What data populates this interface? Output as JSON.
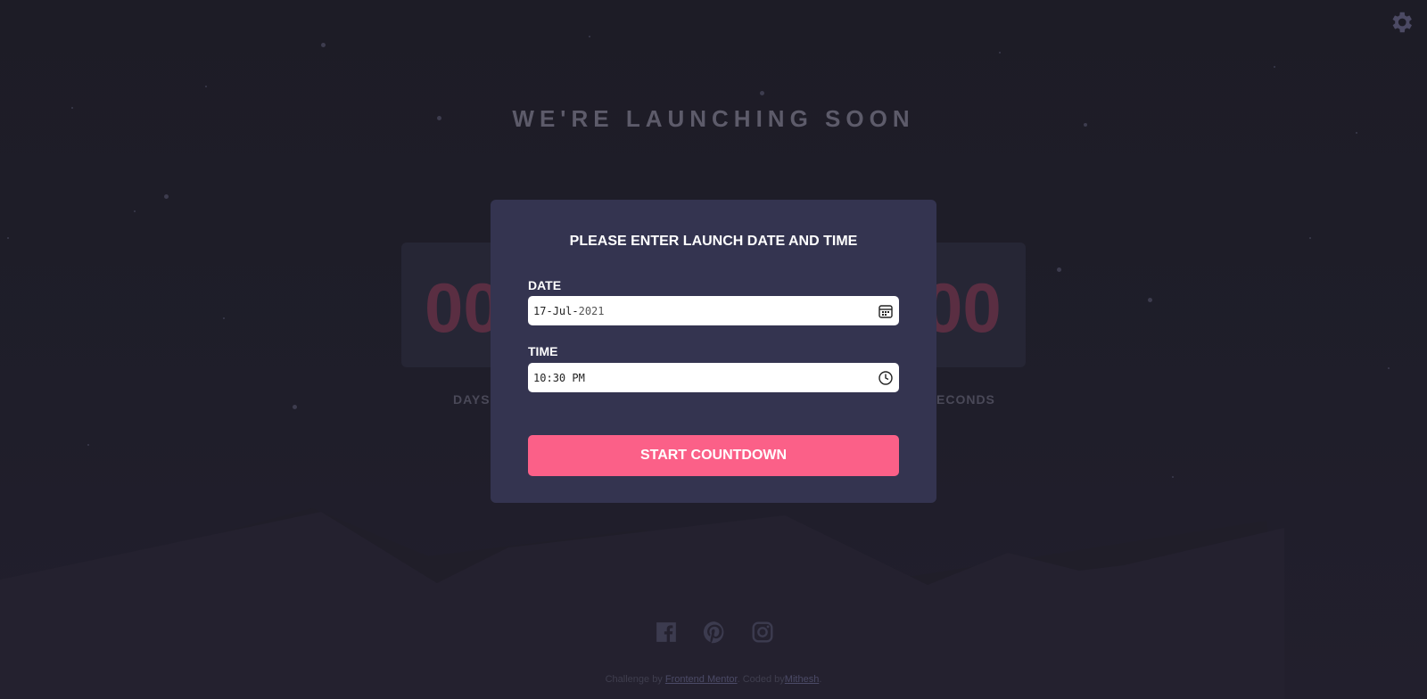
{
  "page": {
    "heading": "WE'RE LAUNCHING SOON"
  },
  "countdown": {
    "days": "00",
    "seconds": "00",
    "label_days": "DAYS",
    "label_seconds": "ECONDS"
  },
  "modal": {
    "title": "PLEASE ENTER LAUNCH DATE AND TIME",
    "date_label": "DATE",
    "date_day": "17",
    "date_month": "Jul",
    "date_year": "2021",
    "time_label": "TIME",
    "time_hour": "10",
    "time_minute": "30",
    "time_ampm": "PM",
    "button": "START COUNTDOWN"
  },
  "footer": {
    "credit_prefix": "Challenge by ",
    "credit_link": "Frontend Mentor",
    "credit_mid": ". Coded by",
    "author_link": "Mithesh",
    "credit_suffix": "."
  },
  "icons": {
    "settings": "gear-icon",
    "facebook": "facebook-icon",
    "pinterest": "pinterest-icon",
    "instagram": "instagram-icon",
    "calendar": "calendar-icon",
    "clock": "clock-icon"
  },
  "colors": {
    "accent": "#fb6088",
    "modal_bg": "#343450",
    "page_bg": "#1e1d27"
  }
}
